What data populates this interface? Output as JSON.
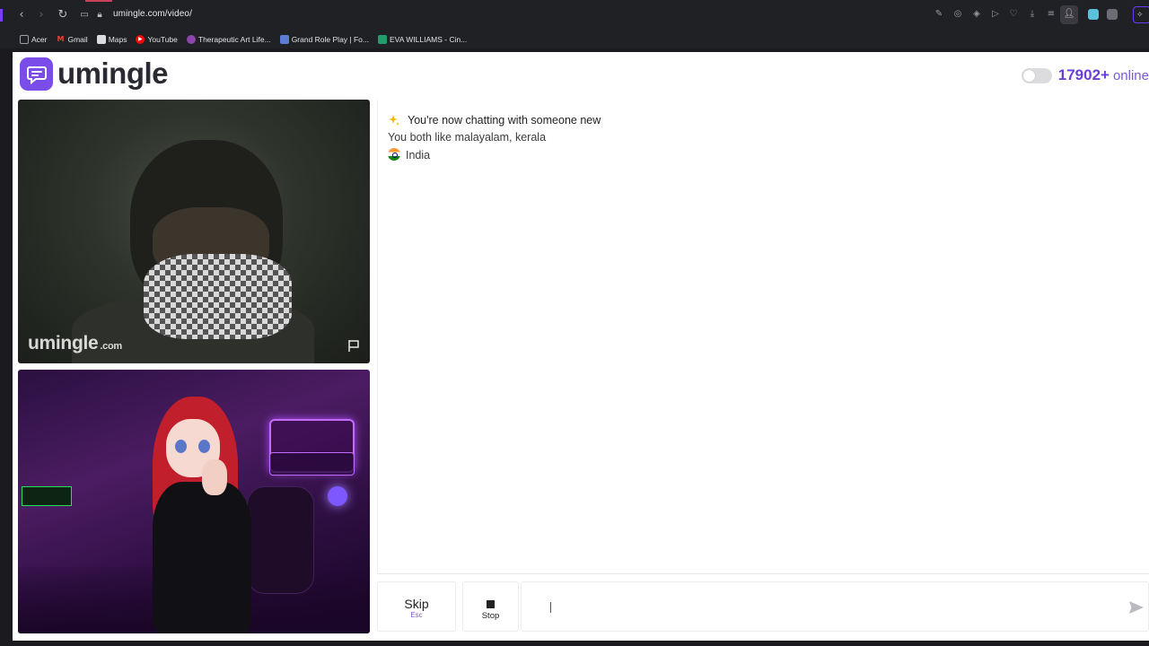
{
  "browser": {
    "url": "umingle.com/video/",
    "bookmarks": [
      {
        "label": "Acer",
        "icon": "folder-icon",
        "color": "#9aa0a6"
      },
      {
        "label": "Gmail",
        "icon": "gmail-icon",
        "color": "#ea4335"
      },
      {
        "label": "Maps",
        "icon": "document-icon",
        "color": "#9aa0a6"
      },
      {
        "label": "YouTube",
        "icon": "youtube-icon",
        "color": "#ff0000"
      },
      {
        "label": "Therapeutic Art Life...",
        "icon": "site-icon",
        "color": "#8e44ad"
      },
      {
        "label": "Grand Role Play | Fo...",
        "icon": "image-icon",
        "color": "#5b7bd5"
      },
      {
        "label": "EVA WILLIAMS - Cin...",
        "icon": "site-icon",
        "color": "#1e9e6a"
      }
    ]
  },
  "header": {
    "logo_text": "umingle",
    "online_count": "17902+",
    "online_label": "online",
    "accent_color": "#7a4de8"
  },
  "remote_video": {
    "watermark_main": "umingle",
    "watermark_suffix": ".com"
  },
  "chat": {
    "title": "You're now chatting with someone new",
    "interests_line": "You both like malayalam, kerala",
    "country": "India"
  },
  "controls": {
    "skip_label": "Skip",
    "skip_hint": "Esc",
    "stop_label": "Stop",
    "input_value": "",
    "input_placeholder": ""
  }
}
